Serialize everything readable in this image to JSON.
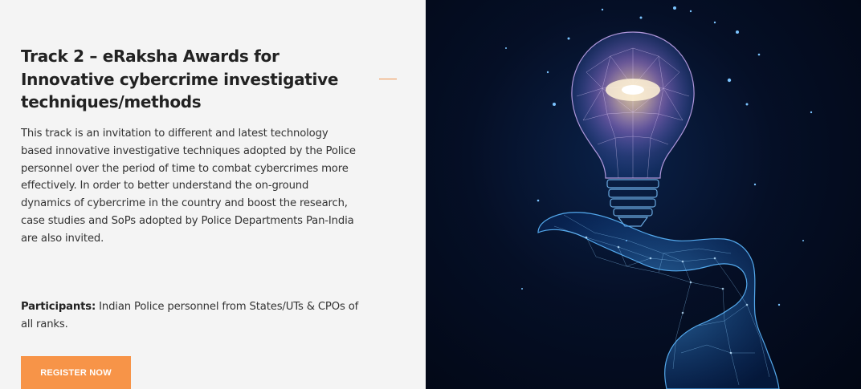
{
  "track": {
    "title_lines": [
      "Track 2 – eRaksha Awards for",
      "Innovative cybercrime investigative",
      "techniques/methods"
    ],
    "description_lines": [
      "This track is an invitation to different and latest technology",
      "based innovative investigative techniques adopted by the Police",
      "personnel over the period of time to combat cybercrimes more",
      "effectively. In order to better understand the on-ground",
      "dynamics of cybercrime in the country and boost the research,",
      "case studies and SoPs adopted by Police Departments Pan-India",
      "are also invited."
    ],
    "participants_label": "Participants:",
    "participants_lines": [
      " Indian Police personnel from States/UTs & CPOs of",
      "all ranks."
    ],
    "register_label": "REGISTER NOW"
  },
  "hero_image": {
    "subject": "lightbulb-over-hand",
    "colors": {
      "background": "#050f26",
      "glow": "#ffd9a0",
      "wire": "#4aa8ff",
      "bulb_tint": "#e9b4ff"
    }
  },
  "colors": {
    "accent": "#f79448",
    "panel_bg": "#f4f4f4",
    "heading": "#222222",
    "body_text": "#333333"
  }
}
